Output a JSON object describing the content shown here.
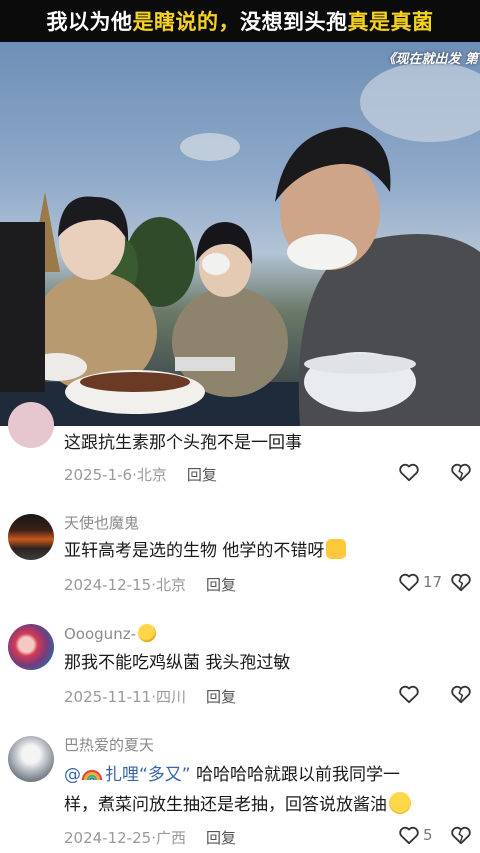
{
  "banner": {
    "title_part1": "我以为他",
    "title_part2": "是瞎说的，",
    "title_part3": "没想到头孢",
    "title_part4": "真是真菌"
  },
  "video": {
    "show_title": "《现在就出发 第"
  },
  "colors": {
    "banner_bg": "#0b0b0b",
    "banner_highlight": "#f5d21f",
    "username": "#8b8b8b",
    "mention": "#3a64a8",
    "meta": "#9a9a9a"
  },
  "comments": [
    {
      "username": "",
      "content": "这跟抗生素那个头孢不是一回事",
      "date": "2025-1-6",
      "location": "北京",
      "reply_label": "回复",
      "likes": ""
    },
    {
      "username": "天使也魔鬼",
      "content": "亚轩高考是选的生物 他学的不错呀",
      "emoji": "thumbs-up-emoji",
      "date": "2024-12-15",
      "location": "北京",
      "reply_label": "回复",
      "likes": "17"
    },
    {
      "username": "Ooogunz-",
      "username_emoji": "smile-emoji",
      "content": "那我不能吃鸡纵菌 我头孢过敏",
      "date": "2025-11-11",
      "location": "四川",
      "reply_label": "回复",
      "likes": ""
    },
    {
      "username": "巴热爱的夏天",
      "mention_prefix": "@",
      "mention_name": "扎哩“多又”",
      "content_line1": " 哈哈哈哈就跟以前我同学一",
      "content_line2": "样，煮菜问放生抽还是老抽，回答说放酱油",
      "emoji": "laughing-emoji",
      "date": "2024-12-25",
      "location": "广西",
      "reply_label": "回复",
      "likes": "5"
    }
  ]
}
